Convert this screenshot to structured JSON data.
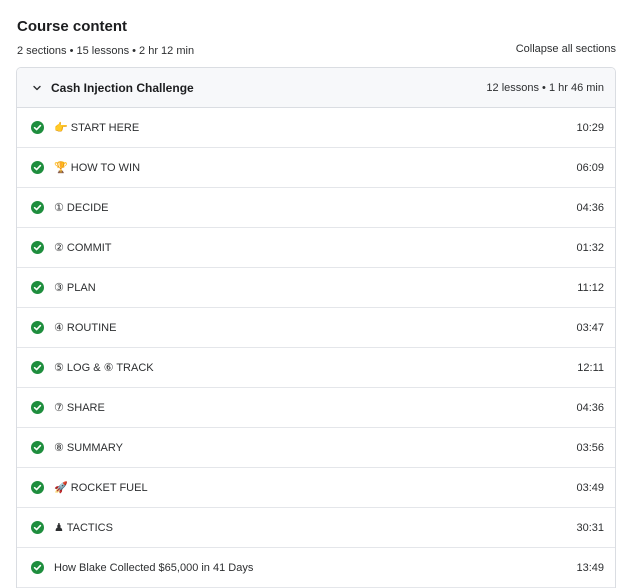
{
  "header": {
    "title": "Course content",
    "summary": "2 sections • 15 lessons • 2 hr 12 min",
    "collapse_label": "Collapse all sections"
  },
  "section": {
    "title": "Cash Injection Challenge",
    "meta": "12 lessons • 1 hr 46 min",
    "expanded": true
  },
  "lessons": [
    {
      "title": "👉 START HERE",
      "duration": "10:29",
      "completed": true
    },
    {
      "title": "🏆 HOW TO WIN",
      "duration": "06:09",
      "completed": true
    },
    {
      "title": "① DECIDE",
      "duration": "04:36",
      "completed": true
    },
    {
      "title": "② COMMIT",
      "duration": "01:32",
      "completed": true
    },
    {
      "title": "③ PLAN",
      "duration": "11:12",
      "completed": true
    },
    {
      "title": "④ ROUTINE",
      "duration": "03:47",
      "completed": true
    },
    {
      "title": "⑤ LOG & ⑥ TRACK",
      "duration": "12:11",
      "completed": true
    },
    {
      "title": "⑦ SHARE",
      "duration": "04:36",
      "completed": true
    },
    {
      "title": "⑧ SUMMARY",
      "duration": "03:56",
      "completed": true
    },
    {
      "title": "🚀 ROCKET FUEL",
      "duration": "03:49",
      "completed": true
    },
    {
      "title": "♟ TACTICS",
      "duration": "30:31",
      "completed": true
    },
    {
      "title": "How Blake Collected $65,000 in 41 Days",
      "duration": "13:49",
      "completed": true
    }
  ],
  "colors": {
    "check": "#1e8e3e",
    "border": "#dadde2",
    "section_bg": "#f7f8fa"
  },
  "icons": {
    "section_toggle": "chevron-down-icon",
    "lesson_status": "check-circle-icon"
  }
}
